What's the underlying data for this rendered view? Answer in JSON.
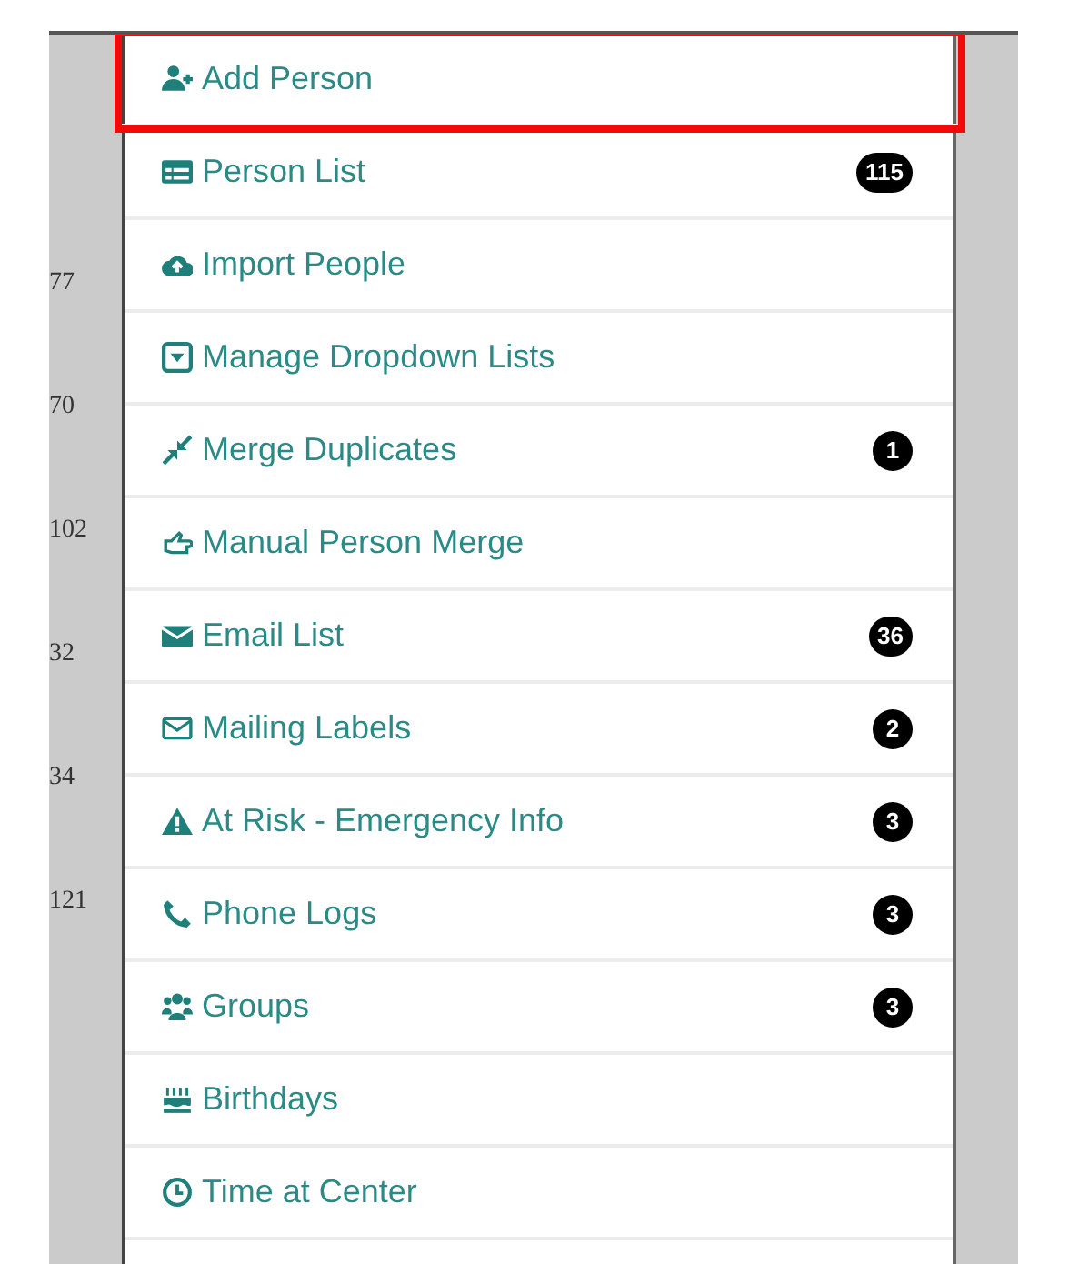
{
  "side_numbers": [
    "77",
    "70",
    "102",
    "32",
    "34",
    "121"
  ],
  "menu": [
    {
      "label": "Add Person",
      "highlighted": true
    },
    {
      "label": "Person List",
      "badge": "115",
      "highlighted": false
    },
    {
      "label": "Import People",
      "highlighted": false
    },
    {
      "label": "Manage Dropdown Lists",
      "highlighted": false
    },
    {
      "label": "Merge Duplicates",
      "badge": "1",
      "highlighted": false
    },
    {
      "label": "Manual Person Merge",
      "highlighted": false
    },
    {
      "label": "Email List",
      "badge": "36",
      "highlighted": false
    },
    {
      "label": "Mailing Labels",
      "badge": "2",
      "highlighted": false
    },
    {
      "label": "At Risk - Emergency Info",
      "badge": "3",
      "highlighted": false
    },
    {
      "label": "Phone Logs",
      "badge": "3",
      "highlighted": false
    },
    {
      "label": "Groups",
      "badge": "3",
      "highlighted": false
    },
    {
      "label": "Birthdays",
      "highlighted": false
    },
    {
      "label": "Time at Center",
      "highlighted": false
    }
  ]
}
